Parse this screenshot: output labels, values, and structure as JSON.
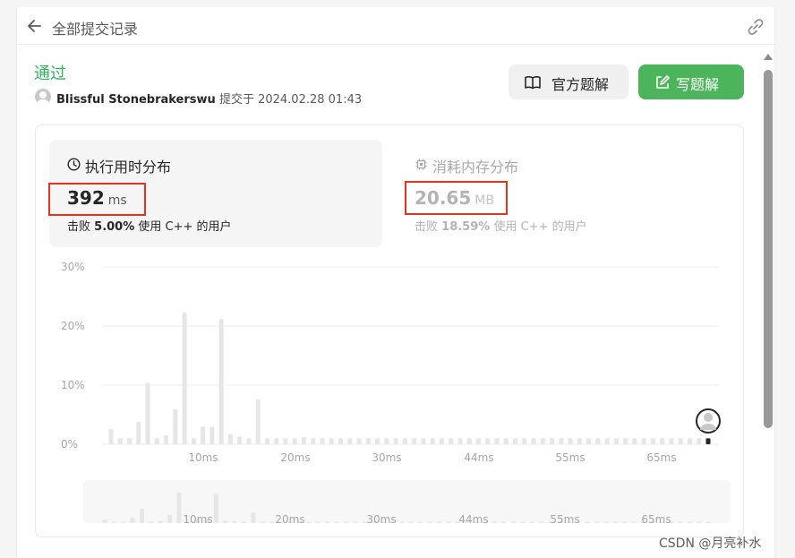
{
  "header": {
    "title": "全部提交记录"
  },
  "submission": {
    "status": "通过",
    "user": "Blissful Stonebrakerswu",
    "submitted_label": "提交于",
    "submitted_at": "2024.02.28 01:43"
  },
  "buttons": {
    "official_solution": "官方题解",
    "write_solution": "写题解"
  },
  "runtime": {
    "title": "执行用时分布",
    "value": "392",
    "unit": "ms",
    "beat_label": "击败",
    "beat_pct": "5.00%",
    "beat_suffix": "使用 C++ 的用户"
  },
  "memory": {
    "title": "消耗内存分布",
    "value": "20.65",
    "unit": "MB",
    "beat_label": "击败",
    "beat_pct": "18.59%",
    "beat_suffix": "使用 C++ 的用户"
  },
  "chart_data": {
    "type": "bar",
    "y_ticks": [
      "30%",
      "20%",
      "10%",
      "0%"
    ],
    "ylim": [
      0,
      30
    ],
    "x_ticks": [
      "10ms",
      "20ms",
      "30ms",
      "44ms",
      "55ms",
      "65ms"
    ],
    "grid": true,
    "values": [
      2.6,
      1.0,
      1.0,
      3.8,
      10.4,
      1.0,
      1.5,
      5.9,
      22.3,
      1.0,
      3.0,
      3.0,
      21.2,
      1.7,
      1.3,
      1.0,
      7.6,
      1.0,
      1.0,
      1.0,
      1.0,
      1.2,
      1.0,
      1.0,
      1.0,
      1.0,
      1.0,
      1.0,
      1.0,
      1.0,
      1.0,
      1.0,
      1.0,
      1.0,
      1.0,
      1.0,
      1.0,
      1.0,
      1.0,
      1.0,
      1.0,
      1.0,
      1.0,
      1.0,
      1.0,
      1.0,
      1.0,
      1.0,
      1.0,
      1.0,
      1.0,
      1.0,
      1.0,
      1.0,
      1.0,
      1.0,
      1.0,
      1.0,
      1.0,
      1.0,
      1.0,
      1.0,
      1.0,
      1.0,
      1.0,
      1.0
    ],
    "highlight_index": 65,
    "overview_x_ticks": [
      "10ms",
      "20ms",
      "30ms",
      "44ms",
      "55ms",
      "65ms"
    ]
  },
  "watermark": "CSDN @月亮补水",
  "colors": {
    "accent_green": "#2db55d",
    "button_green": "#4cb45b",
    "highlight_red": "#e5331c",
    "bar_gray": "#e6e6e6"
  }
}
